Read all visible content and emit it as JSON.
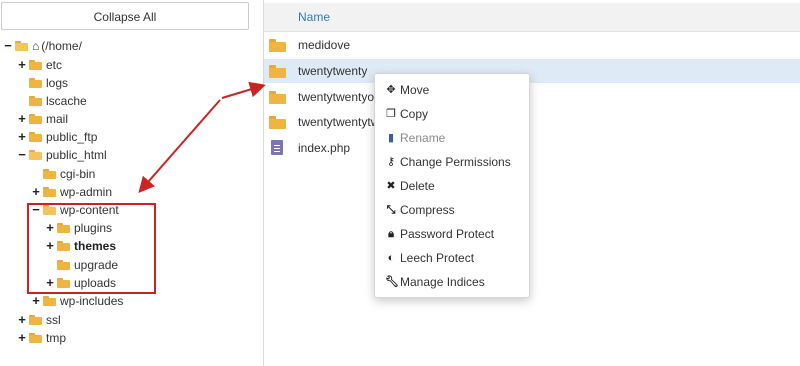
{
  "tree": {
    "collapse_label": "Collapse All",
    "items": [
      {
        "toggle": "−",
        "icon": "folder-open-icon",
        "home": true,
        "label": "(/home/",
        "bold": false
      },
      {
        "toggle": "+",
        "icon": "folder-icon",
        "label": "etc",
        "bold": false
      },
      {
        "toggle": "",
        "icon": "folder-icon",
        "label": "logs",
        "bold": false
      },
      {
        "toggle": "",
        "icon": "folder-icon",
        "label": "lscache",
        "bold": false
      },
      {
        "toggle": "+",
        "icon": "folder-icon",
        "label": "mail",
        "bold": false
      },
      {
        "toggle": "+",
        "icon": "folder-icon",
        "label": "public_ftp",
        "bold": false
      },
      {
        "toggle": "−",
        "icon": "folder-open-icon",
        "label": "public_html",
        "bold": false
      },
      {
        "toggle": "",
        "icon": "folder-icon",
        "label": "cgi-bin",
        "bold": false
      },
      {
        "toggle": "+",
        "icon": "folder-icon",
        "label": "wp-admin",
        "bold": false
      },
      {
        "toggle": "−",
        "icon": "folder-open-icon",
        "label": "wp-content",
        "bold": false
      },
      {
        "toggle": "+",
        "icon": "folder-icon",
        "label": "plugins",
        "bold": false
      },
      {
        "toggle": "+",
        "icon": "folder-icon",
        "label": "themes",
        "bold": true
      },
      {
        "toggle": "",
        "icon": "folder-icon",
        "label": "upgrade",
        "bold": false
      },
      {
        "toggle": "+",
        "icon": "folder-icon",
        "label": "uploads",
        "bold": false
      },
      {
        "toggle": "+",
        "icon": "folder-icon",
        "label": "wp-includes",
        "bold": false
      },
      {
        "toggle": "+",
        "icon": "folder-icon",
        "label": "ssl",
        "bold": false
      },
      {
        "toggle": "+",
        "icon": "folder-icon",
        "label": "tmp",
        "bold": false
      }
    ]
  },
  "list": {
    "column_name": "Name",
    "files": [
      {
        "name": "medidove",
        "type": "folder",
        "selected": false
      },
      {
        "name": "twentytwenty",
        "type": "folder",
        "selected": true
      },
      {
        "name": "twentytwentyor",
        "type": "folder",
        "selected": false
      },
      {
        "name": "twentytwentytw",
        "type": "folder",
        "selected": false
      },
      {
        "name": "index.php",
        "type": "file",
        "selected": false
      }
    ]
  },
  "context_menu": {
    "items": [
      {
        "label": "Move",
        "icon": "move-icon",
        "glyph": "✥",
        "disabled": false
      },
      {
        "label": "Copy",
        "icon": "copy-icon",
        "glyph": "❐",
        "disabled": false
      },
      {
        "label": "Rename",
        "icon": "rename-icon",
        "glyph": "▮",
        "disabled": true
      },
      {
        "label": "Change Permissions",
        "icon": "key-icon",
        "glyph": "⚷",
        "disabled": false
      },
      {
        "label": "Delete",
        "icon": "delete-icon",
        "glyph": "✖",
        "disabled": false
      },
      {
        "label": "Compress",
        "icon": "compress-icon",
        "glyph": "⤡",
        "disabled": false
      },
      {
        "label": "Password Protect",
        "icon": "lock-icon",
        "glyph": "🔒︎",
        "disabled": false
      },
      {
        "label": "Leech Protect",
        "icon": "shield-icon",
        "glyph": "◐",
        "disabled": false
      },
      {
        "label": "Manage Indices",
        "icon": "wrench-icon",
        "glyph": "🔧︎",
        "disabled": false
      }
    ]
  },
  "colors": {
    "accent": "#2f7bbf",
    "folder": "#f0b443",
    "selected_row": "#dfeaf7",
    "annotation": "#cc2222"
  }
}
